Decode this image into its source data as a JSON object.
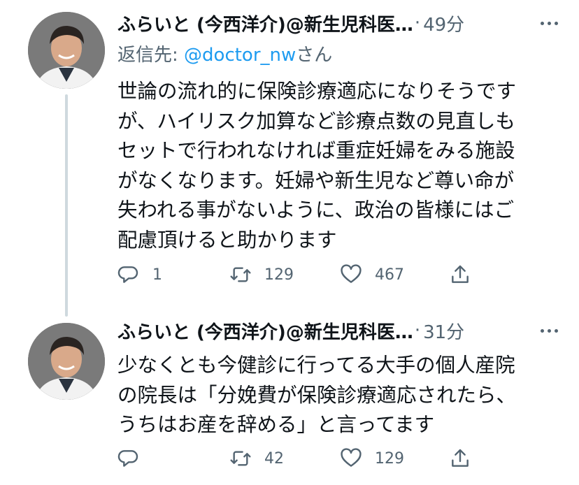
{
  "tweets": [
    {
      "author": "ふらいと (今西洋介)@新生児科医…",
      "time": "49分",
      "reply_prefix": "返信先: ",
      "reply_handle": "@doctor_nw",
      "reply_suffix": "さん",
      "body_lines": [
        "世論の流れ的に保険診療適応になりそうです",
        "が、ハイリスク加算など診療点数の見直しも",
        "セットで行われなければ重症妊婦をみる施設",
        "がなくなります。妊婦や新生児など尊い命が",
        "失われる事がないように、政治の皆様にはご",
        "配慮頂けると助かります"
      ],
      "replies": "1",
      "retweets": "129",
      "likes": "467"
    },
    {
      "author": "ふらいと (今西洋介)@新生児科医…",
      "time": "31分",
      "body_lines": [
        "少なくとも今健診に行ってる大手の個人産院",
        "の院長は「分娩費が保険診療適応されたら、",
        "うちはお産を辞める」と言ってます"
      ],
      "replies": "",
      "retweets": "42",
      "likes": "129"
    }
  ],
  "colors": {
    "text": "#0f1419",
    "secondary": "#536471",
    "link": "#1d9bf0",
    "thread_line": "#cfd9de"
  },
  "icons": [
    "reply-icon",
    "retweet-icon",
    "like-icon",
    "share-icon",
    "more-icon"
  ]
}
